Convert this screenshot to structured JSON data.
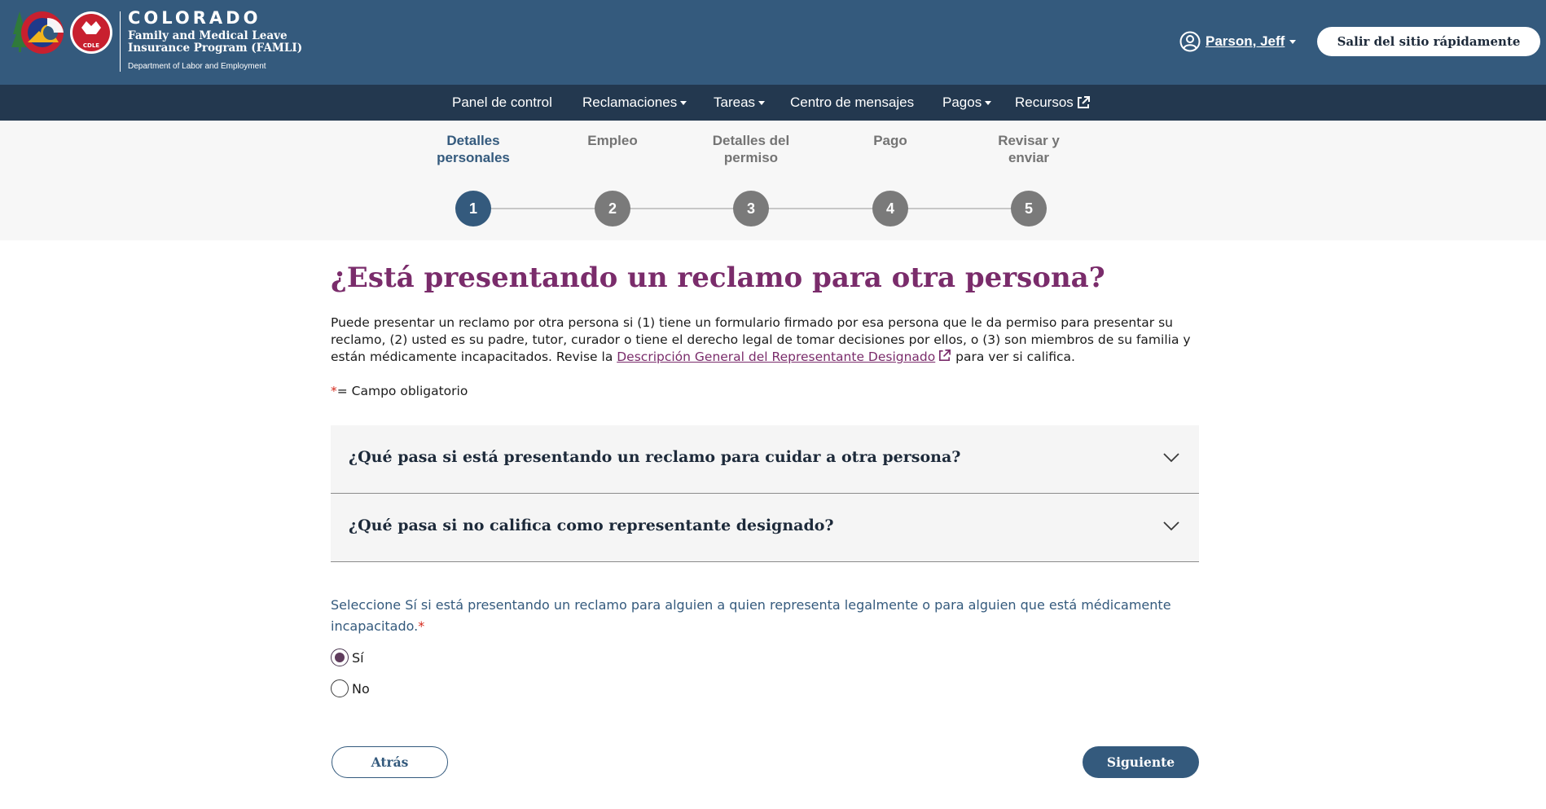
{
  "header": {
    "brand": "COLORADO",
    "program": "Family and Medical Leave Insurance Program (FAMLI)",
    "department": "Department of Labor and Employment",
    "logo_badge": "CDLE",
    "logo_icon": "colorado-cdle-logo",
    "user_icon": "user-circle-icon",
    "user_name": "Parson, Jeff",
    "exit_button": "Salir del sitio rápidamente",
    "colors": {
      "header_bg": "#345a7d",
      "nav_bg": "#23384f"
    }
  },
  "nav": {
    "items": [
      {
        "label": "Panel de control",
        "has_dropdown": false
      },
      {
        "label": "Reclamaciones",
        "has_dropdown": true
      },
      {
        "label": "Tareas",
        "has_dropdown": true
      },
      {
        "label": "Centro de mensajes",
        "has_dropdown": false
      },
      {
        "label": "Pagos",
        "has_dropdown": true
      },
      {
        "label": "Recursos",
        "external": true,
        "icon": "external-link-icon"
      }
    ]
  },
  "steps": {
    "current": 1,
    "items": [
      {
        "number": "1",
        "label_line1": "Detalles",
        "label_line2": "personales"
      },
      {
        "number": "2",
        "label_line1": "Empleo",
        "label_line2": ""
      },
      {
        "number": "3",
        "label_line1": "Detalles del",
        "label_line2": "permiso"
      },
      {
        "number": "4",
        "label_line1": "Pago",
        "label_line2": ""
      },
      {
        "number": "5",
        "label_line1": "Revisar y",
        "label_line2": "enviar"
      }
    ]
  },
  "main": {
    "title": "¿Está presentando un reclamo para otra persona?",
    "intro_before": "Puede presentar un reclamo por otra persona si (1) tiene un formulario firmado por esa persona que le da permiso para presentar su reclamo, (2) usted es su padre, tutor, curador o tiene el derecho legal de tomar decisiones por ellos, o (3) son miembros de su familia y están médicamente incapacitados. Revise la ",
    "intro_link": "Descripción General del Representante Designado",
    "intro_after": " para ver si califica.",
    "required_star": "*",
    "required_note": "= Campo obligatorio",
    "accordions": [
      {
        "title": "¿Qué pasa si está presentando un reclamo para cuidar a otra persona?",
        "icon": "chevron-down-icon"
      },
      {
        "title": "¿Qué pasa si no califica como representante designado?",
        "icon": "chevron-down-icon"
      }
    ],
    "question": "Seleccione Sí si está presentando un reclamo para alguien a quien representa legalmente o para alguien que está médicamente incapacitado.",
    "question_star": "*",
    "options": [
      {
        "label": "Sí",
        "selected": true
      },
      {
        "label": "No",
        "selected": false
      }
    ],
    "back_button": "Atrás",
    "next_button": "Siguiente",
    "colors": {
      "title": "#7a2c6b",
      "question": "#345a7d",
      "required": "#d52b1e"
    }
  }
}
